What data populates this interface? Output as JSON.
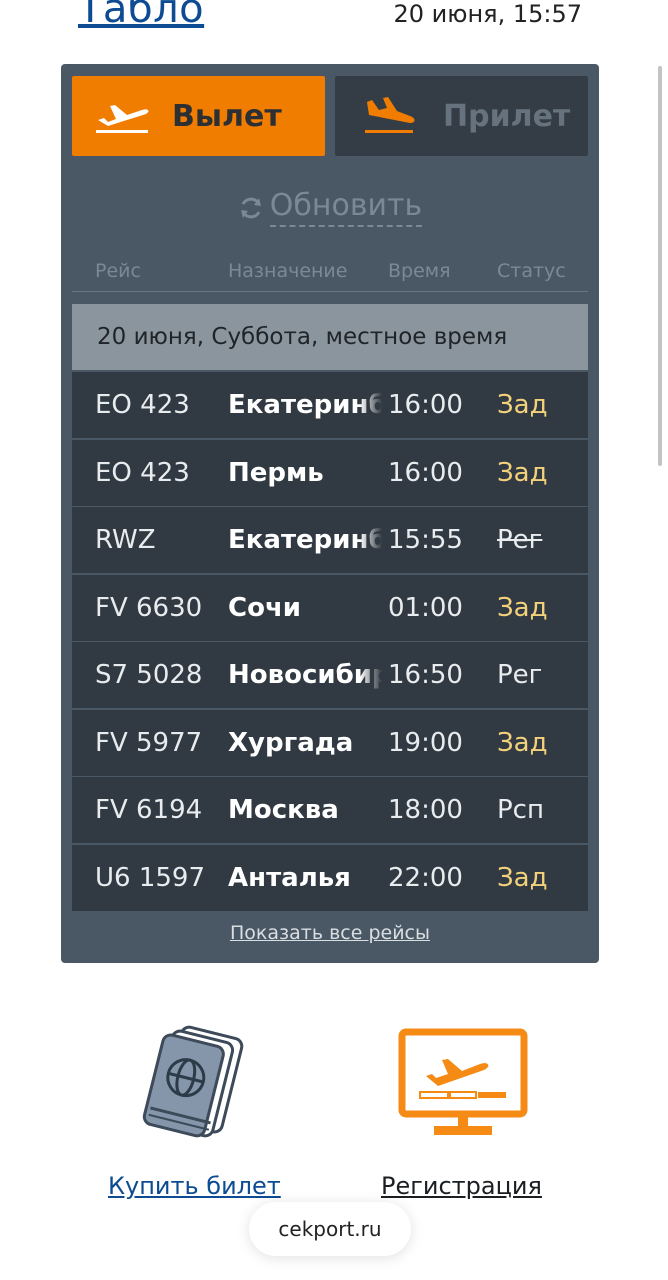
{
  "header": {
    "title": "Табло",
    "datetime": "20 июня, 15:57"
  },
  "tabs": {
    "departure": {
      "label": "Вылет",
      "icon": "plane-takeoff-icon",
      "active": true
    },
    "arrival": {
      "label": "Прилет",
      "icon": "plane-landing-icon",
      "active": false
    }
  },
  "refresh": {
    "label": "Обновить",
    "icon": "refresh-icon"
  },
  "table": {
    "columns": [
      "Рейс",
      "Назначение",
      "Время",
      "Статус"
    ],
    "day_label": "20 июня, Суббота, местное время",
    "rows": [
      {
        "flight": "EO 423",
        "destination": "Екатеринбург",
        "time": "16:00",
        "status": "Зад",
        "status_type": "delay"
      },
      {
        "flight": "EO 423",
        "destination": "Пермь",
        "time": "16:00",
        "status": "Зад",
        "status_type": "delay"
      },
      {
        "flight": "RWZ",
        "destination": "Екатеринбург",
        "time": "15:55",
        "status": "Рег",
        "status_type": "struck"
      },
      {
        "flight": "FV 6630",
        "destination": "Сочи",
        "time": "01:00",
        "status": "Зад",
        "status_type": "delay"
      },
      {
        "flight": "S7 5028",
        "destination": "Новосибирск",
        "time": "16:50",
        "status": "Рег",
        "status_type": "reg"
      },
      {
        "flight": "FV 5977",
        "destination": "Хургада",
        "time": "19:00",
        "status": "Зад",
        "status_type": "delay"
      },
      {
        "flight": "FV 6194",
        "destination": "Москва",
        "time": "18:00",
        "status": "Рсп",
        "status_type": "reg"
      },
      {
        "flight": "U6 1597",
        "destination": "Анталья",
        "time": "22:00",
        "status": "Зад",
        "status_type": "delay"
      }
    ],
    "show_all_label": "Показать все рейсы"
  },
  "services": {
    "buy": {
      "label": "Купить билет",
      "icon": "passport-icon"
    },
    "register": {
      "label": "Регистрация",
      "icon": "monitor-plane-icon"
    }
  },
  "browser": {
    "url": "cekport.ru"
  },
  "colors": {
    "accent": "#f07d00",
    "board_bg": "#4a5866",
    "row_bg": "#313a42",
    "delay": "#f2d17a",
    "link": "#0d4c92"
  }
}
